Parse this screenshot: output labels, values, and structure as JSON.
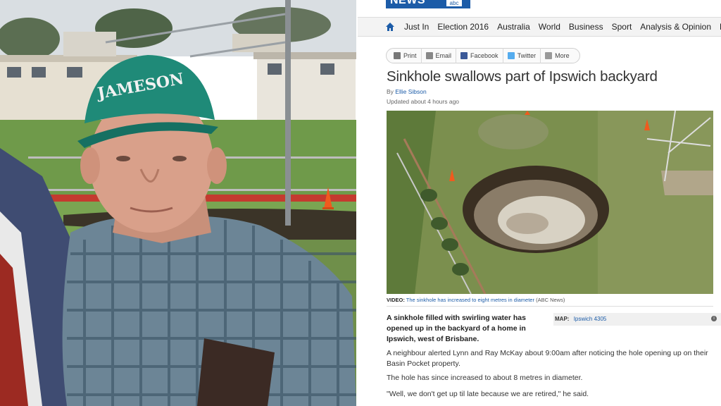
{
  "site": {
    "logo_text": "NEWS",
    "logo_mark": "abc"
  },
  "nav": {
    "items": [
      "Just In",
      "Election 2016",
      "Australia",
      "World",
      "Business",
      "Sport",
      "Analysis & Opinion",
      "Fact Check"
    ]
  },
  "share": {
    "print": "Print",
    "email": "Email",
    "facebook": "Facebook",
    "twitter": "Twitter",
    "more": "More"
  },
  "article": {
    "headline": "Sinkhole swallows part of Ipswich backyard",
    "by_prefix": "By",
    "author": "Ellie Sibson",
    "updated": "Updated about 4 hours ago",
    "caption_label": "VIDEO:",
    "caption_text": "The sinkhole has increased to eight metres in diameter",
    "caption_source": "(ABC News)",
    "lead": "A sinkhole filled with swirling water has opened up in the backyard of a home in Ipswich, west of Brisbane.",
    "map_label": "MAP:",
    "map_link": "Ipswich 4305",
    "map_info": "i",
    "p1": "A neighbour alerted Lynn and Ray McKay about 9:00am after noticing the hole opening up on their Basin Pocket property.",
    "p2": "The hole has since increased to about 8 metres in diameter.",
    "p3": "\"Well, we don't get up til late because we are retired,\" he said."
  },
  "photo": {
    "cap_text": "JAMESON"
  },
  "colors": {
    "brand_blue": "#1c5ca8",
    "facebook": "#3b5998",
    "twitter": "#55acee",
    "cone": "#f05a1e"
  },
  "icons": {
    "home": "home-icon",
    "print": "print-icon",
    "email": "email-icon",
    "facebook": "facebook-icon",
    "twitter": "twitter-icon",
    "more": "more-icon"
  }
}
